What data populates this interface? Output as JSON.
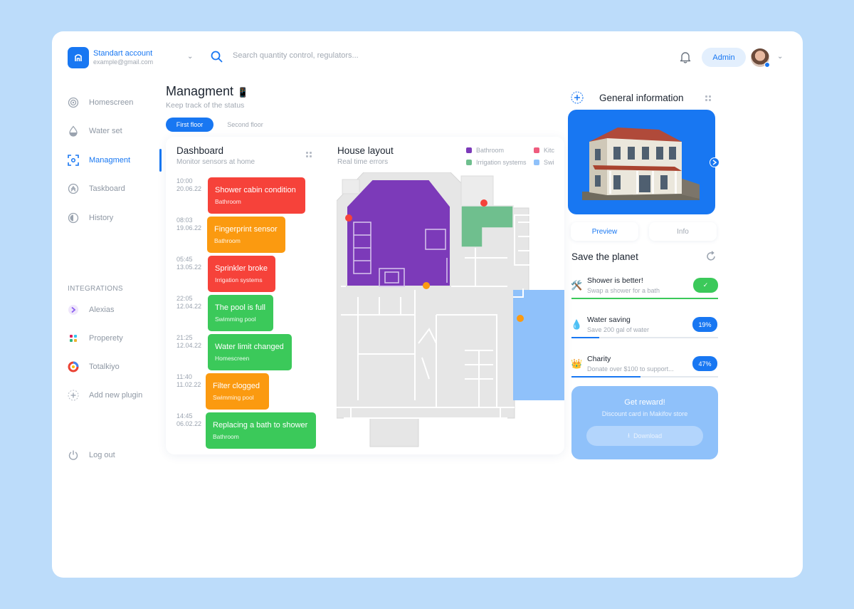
{
  "account": {
    "name": "Standart account",
    "email": "example@gmail.com"
  },
  "search": {
    "placeholder": "Search quantity control, regulators..."
  },
  "header": {
    "admin_label": "Admin"
  },
  "sidebar": {
    "items": [
      {
        "label": "Homescreen",
        "icon": "target-icon"
      },
      {
        "label": "Water set",
        "icon": "water-drop-icon"
      },
      {
        "label": "Managment",
        "icon": "scan-icon",
        "active": true
      },
      {
        "label": "Taskboard",
        "icon": "rocket-icon"
      },
      {
        "label": "History",
        "icon": "history-icon"
      }
    ],
    "integrations_label": "INTEGRATIONS",
    "integrations": [
      {
        "label": "Alexias",
        "icon": "alexias-icon"
      },
      {
        "label": "Properety",
        "icon": "properety-icon"
      },
      {
        "label": "Totalkiyo",
        "icon": "totalkiyo-icon"
      },
      {
        "label": "Add new plugin",
        "icon": "plus-icon"
      }
    ],
    "logout_label": "Log out"
  },
  "page": {
    "title": "Managment",
    "title_emoji": "📱",
    "subtitle": "Keep track of the status",
    "tabs": [
      "First floor",
      "Second floor"
    ]
  },
  "dashboard": {
    "title": "Dashboard",
    "subtitle": "Monitor sensors at home",
    "events": [
      {
        "time": "10:00",
        "date": "20.06.22",
        "title": "Shower cabin condition",
        "sub": "Bathroom",
        "status": "error"
      },
      {
        "time": "08:03",
        "date": "19.06.22",
        "title": "Fingerprint sensor",
        "sub": "Bathroom",
        "status": "warning"
      },
      {
        "time": "05:45",
        "date": "13.05.22",
        "title": "Sprinkler broke",
        "sub": "Irrigation systems",
        "status": "error"
      },
      {
        "time": "22:05",
        "date": "12.04.22",
        "title": "The pool is full",
        "sub": "Swimming pool",
        "status": "ok"
      },
      {
        "time": "21:25",
        "date": "12.04.22",
        "title": "Water limit changed",
        "sub": "Homescreen",
        "status": "ok"
      },
      {
        "time": "11:40",
        "date": "11.02.22",
        "title": "Filter clogged",
        "sub": "Swimming pool",
        "status": "warning"
      },
      {
        "time": "14:45",
        "date": "06.02.22",
        "title": "Replacing a bath to shower",
        "sub": "Bathroom",
        "status": "ok"
      }
    ],
    "status_colors": {
      "error": "#f6423a",
      "warning": "#fb9a10",
      "ok": "#3bc95a"
    }
  },
  "layout": {
    "title": "House layout",
    "subtitle": "Real time errors",
    "legend": [
      {
        "label": "Bathroom",
        "color": "#7c3ab9"
      },
      {
        "label": "Kitc",
        "color": "#ef5c7e"
      },
      {
        "label": "Irrigation systems",
        "color": "#6fbf8e"
      },
      {
        "label": "Swi",
        "color": "#8fc1fa"
      }
    ]
  },
  "info": {
    "title": "General information",
    "tabs": [
      "Preview",
      "Info"
    ],
    "save_title": "Save the planet",
    "goals": [
      {
        "emoji": "🛠️",
        "title": "Shower is better!",
        "sub": "Swap a shower for a bath",
        "pill": "✓",
        "progress": 1.0,
        "color": "#3bc95a"
      },
      {
        "emoji": "💧",
        "title": "Water saving",
        "sub": "Save 200 gal of water",
        "pill": "19%",
        "progress": 0.19,
        "color": "#1877f2"
      },
      {
        "emoji": "👑",
        "title": "Charity",
        "sub": "Donate over $100 to support...",
        "pill": "47%",
        "progress": 0.47,
        "color": "#1877f2"
      }
    ],
    "reward": {
      "title": "Get reward!",
      "sub": "Discount card in Makifov store",
      "button": "Download"
    }
  }
}
